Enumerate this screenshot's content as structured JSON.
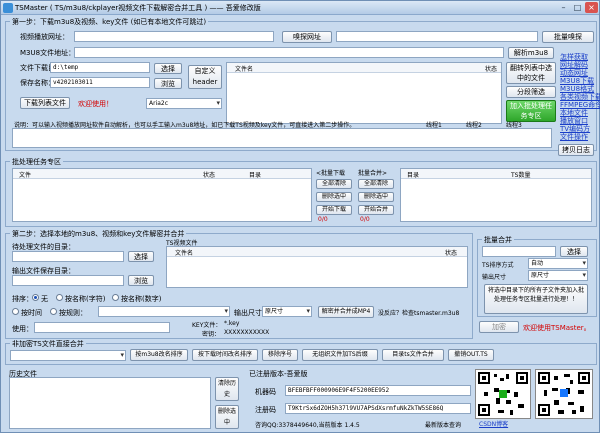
{
  "window": {
    "title": "TSMaster ( TS/m3u8/ckplayer视频文件下载解密合并工具 ) —— 吾爱修改版",
    "controls": [
      "–",
      "□",
      "×"
    ]
  },
  "step1": {
    "group_title": "第一步：下载m3u8及视频、key文件 (如已有本地文件可跳过)",
    "video_url_label": "视频播放网址：",
    "video_url_value": "",
    "sniff_button": "嗅探网址",
    "batch_sniff_button": "批量嗅探",
    "m3u8_label": "M3U8文件地址：",
    "m3u8_value": "",
    "parse_button": "解析m3u8",
    "save_dir_label": "文件下载目录：",
    "save_dir_value": "d:\\temp",
    "choose_button": "选择",
    "custom_header_button": "自定义header",
    "save_name_label": "保存名称：",
    "save_name_value": "v4202103011",
    "browse_button": "浏览",
    "list_col_filename": "文件名",
    "list_col_status": "状态",
    "download_list_button": "下载列表文件",
    "welcome_text": "欢迎使用！",
    "quality_select": "Aria2c",
    "sort_list_button": "翻转列表中选中的文件",
    "split_button": "分段筛选",
    "add_batch_button": "加入批处理任务专区",
    "links": [
      "怎样获取",
      "网址解码",
      "动态网址",
      "M3U8下载",
      "M3U8格式",
      "各类视频下载",
      "FFMPEG命令",
      "本地文件",
      "播放窗口",
      "TV编码方",
      "文件操作"
    ],
    "description": "说明：可以输入视频播放网址软件自动解析，也可以手工输入m3u8地址，如已下载TS视频及key文件，可直接进入第二步操作。",
    "thread1": "线程1",
    "thread2": "线程2",
    "thread3": "线程3",
    "copy_log_button": "拷贝日志"
  },
  "batch": {
    "group_title": "批处理任务专区",
    "left_cols": [
      "文件",
      "状态",
      "目录"
    ],
    "batch_download_label": "<批量下载",
    "batch_merge_label": "批量合并>",
    "clear_all_1": "全部清除",
    "clear_all_2": "全部清除",
    "delete_sel_1": "删除选中",
    "delete_sel_2": "删除选中",
    "start_download": "开始下载",
    "start_merge": "开始合并",
    "count_left": "0/0",
    "count_right": "0/0",
    "right_cols": [
      "目录",
      "TS数量"
    ]
  },
  "step2": {
    "group_title": "第二步：选择本地的m3u8、视频和key文件解密并合并",
    "pending_dir_label": "待处理文件的目录：",
    "choose1": "选择",
    "output_dir_label": "输出文件保存目录：",
    "browse2": "浏览",
    "ts_list_title": "TS视频文件",
    "ts_cols": [
      "文件名",
      "状态"
    ],
    "sort_label": "排序：",
    "sort_none": "无",
    "sort_name": "按名称(字符)",
    "sort_num": "按名称(数字)",
    "by_time": "按时间",
    "by_rule": "按规则：",
    "output_size_label": "输出尺寸",
    "output_size_value": "原尺寸",
    "decrypt_button": "解密并合并成MP4",
    "check_text": "没反应？检查tsmaster.m3u8",
    "use_label": "使用：",
    "key_label": "KEY文件：",
    "key_value": "*.key",
    "secret_label": "密钥：",
    "secret_value": "XXXXXXXXXXX",
    "encrypt_button": "加密",
    "welcome2": "欢迎使用TSMaster。"
  },
  "batch_merge": {
    "group_title": "批量合并",
    "choose": "选择",
    "sort_label": "TS排序方式",
    "sort_value": "自动",
    "size_label": "输出尺寸",
    "size_value": "原尺寸",
    "big_button": "将选中目录下的所有子文件夹加入批处理任务专区批量进行处理！！"
  },
  "nonencrypt": {
    "group_title": "非加密TS文件直接合并",
    "btn1": "按m3u8改名排序",
    "btn2": "按下载时间改名排序",
    "btn3": "移除序号",
    "btn4": "无组织文件加TS后缀",
    "btn5": "目录ts文件合并",
    "btn6": "撤销OUT.TS"
  },
  "history": {
    "title": "历史文件",
    "clear_button": "清除历史",
    "delete_button": "删除选中"
  },
  "register": {
    "title": "已注册版本-吾爱版",
    "machine_label": "机器码",
    "machine_value": "BFEBFBFF000906E9F4F5200EE952",
    "reg_label": "注册码",
    "reg_value": "T9KtrSx6dZOH5h37l9VU7APSdXsrmfuNkZkTW5SE86Q",
    "qq_text": "咨询QQ:3378449640,当前版本 1.4.5",
    "latest_label": "最新版本查询",
    "csdn_link": "CSDN博客"
  },
  "colors": {
    "accent": "#1a3ec8",
    "alert": "#d40000",
    "green": "#2ea62a"
  }
}
